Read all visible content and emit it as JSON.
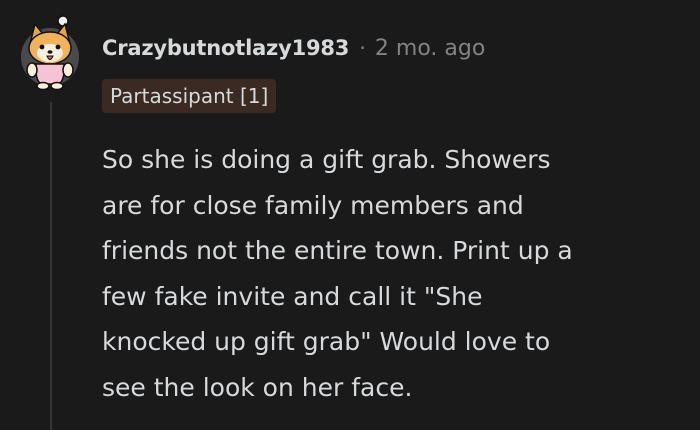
{
  "comment": {
    "username": "Crazybutnotlazy1983",
    "separator": "·",
    "time": "2 mo. ago",
    "flair": "Partassipant [1]",
    "body_lines": [
      "So she is doing a gift grab. Showers",
      "are for close family members and",
      "friends not the entire town. Print up a",
      "few fake invite and call it \"She",
      "knocked up gift grab\" Would love to",
      "see the look on her face."
    ],
    "avatar_icon": "snoo-avatar-icon",
    "colors": {
      "background": "#1a1a1b",
      "text": "#d7dadc",
      "meta": "#818384",
      "flair_bg": "#3a2a22"
    }
  }
}
